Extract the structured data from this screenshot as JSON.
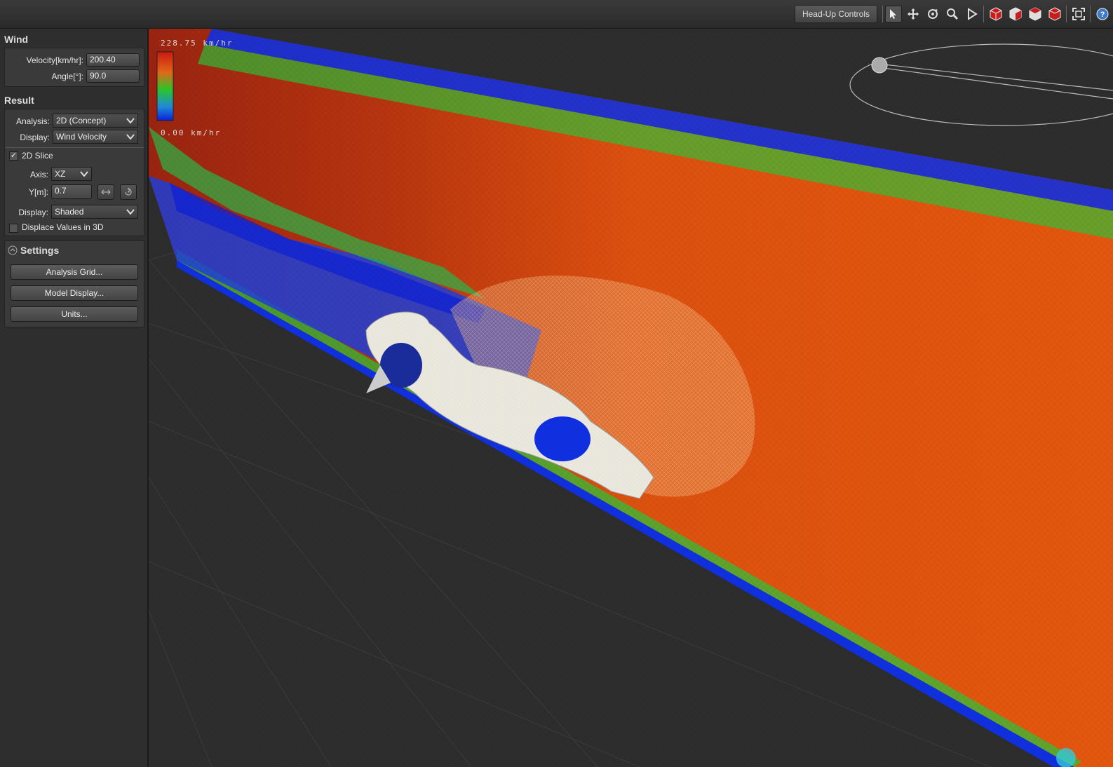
{
  "toolbar": {
    "headup_label": "Head-Up Controls",
    "tools": [
      "select-arrow-icon",
      "pan-icon",
      "orbit-icon",
      "zoom-icon",
      "play-icon",
      "view-cube-front-icon",
      "view-cube-side-icon",
      "view-cube-top-icon",
      "view-cube-iso-icon",
      "fit-view-icon",
      "help-icon"
    ]
  },
  "wind": {
    "title": "Wind",
    "velocity_label": "Velocity[km/hr]:",
    "velocity_value": "200.40",
    "angle_label": "Angle[°]:",
    "angle_value": "90.0"
  },
  "result": {
    "title": "Result",
    "analysis_label": "Analysis:",
    "analysis_value": "2D (Concept)",
    "display_label": "Display:",
    "display_value": "Wind Velocity",
    "slice_label": "2D Slice",
    "slice_checked": true,
    "axis_label": "Axis:",
    "axis_value": "XZ",
    "y_label": "Y[m]:",
    "y_value": "0.7",
    "display2_label": "Display:",
    "display2_value": "Shaded",
    "displace_label": "Displace Values in 3D",
    "displace_checked": false
  },
  "settings": {
    "title": "Settings",
    "buttons": [
      "Analysis Grid...",
      "Model Display...",
      "Units..."
    ]
  },
  "legend": {
    "max_label": "228.75 km/hr",
    "min_label": "0.00 km/hr"
  },
  "colors": {
    "flow_orange": "#e0520f",
    "flow_red": "#b8280c",
    "flow_green": "#33cc33",
    "flow_blue": "#0b1fd8",
    "car_white": "#e8e6da"
  }
}
